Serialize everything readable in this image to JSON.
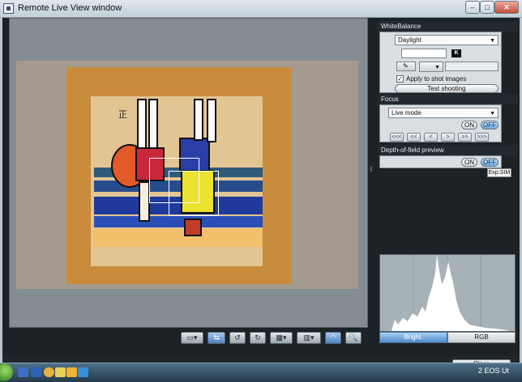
{
  "window": {
    "title": "Remote Live View window",
    "min_glyph": "–",
    "max_glyph": "□",
    "close_glyph": "✕"
  },
  "toolbar": {
    "buttons": [
      {
        "name": "screen-mode-icon",
        "glyph": "▭▾"
      },
      {
        "name": "compare-icon",
        "glyph": "⇆"
      },
      {
        "name": "rotate-left-icon",
        "glyph": "↺"
      },
      {
        "name": "rotate-right-icon",
        "glyph": "↻"
      },
      {
        "name": "grid-icon",
        "glyph": "▦▾"
      },
      {
        "name": "aspect-ratio-icon",
        "glyph": "▥▾"
      },
      {
        "name": "live-view-icon",
        "glyph": "◠"
      },
      {
        "name": "zoom-icon",
        "glyph": "🔍"
      }
    ]
  },
  "white_balance": {
    "title": "WhiteBalance",
    "mode": "Daylight",
    "kelvin_value": "",
    "kelvin_unit": "K",
    "picker_glyph": "✎",
    "apply_checked": true,
    "apply_label": "Apply to shot images",
    "test_button": "Test shooting"
  },
  "focus": {
    "title": "Focus",
    "mode": "Live mode",
    "on_label": "ON",
    "off_label": "OFF",
    "off_selected": true,
    "steps": [
      "<<<",
      "<<",
      "<",
      ">",
      ">>",
      ">>>"
    ],
    "infinity": "∞"
  },
  "dof": {
    "title": "Depth-of-field preview",
    "on_label": "ON",
    "off_label": "OFF",
    "off_selected": true
  },
  "exp_sim": "Exp.SIM",
  "histogram": {
    "tabs": [
      {
        "label": "Bright.",
        "selected": true
      },
      {
        "label": "RGB",
        "selected": false
      }
    ]
  },
  "bottom": {
    "close_label": "Close"
  },
  "taskbar": {
    "tray_text": "2 EOS Ut"
  }
}
